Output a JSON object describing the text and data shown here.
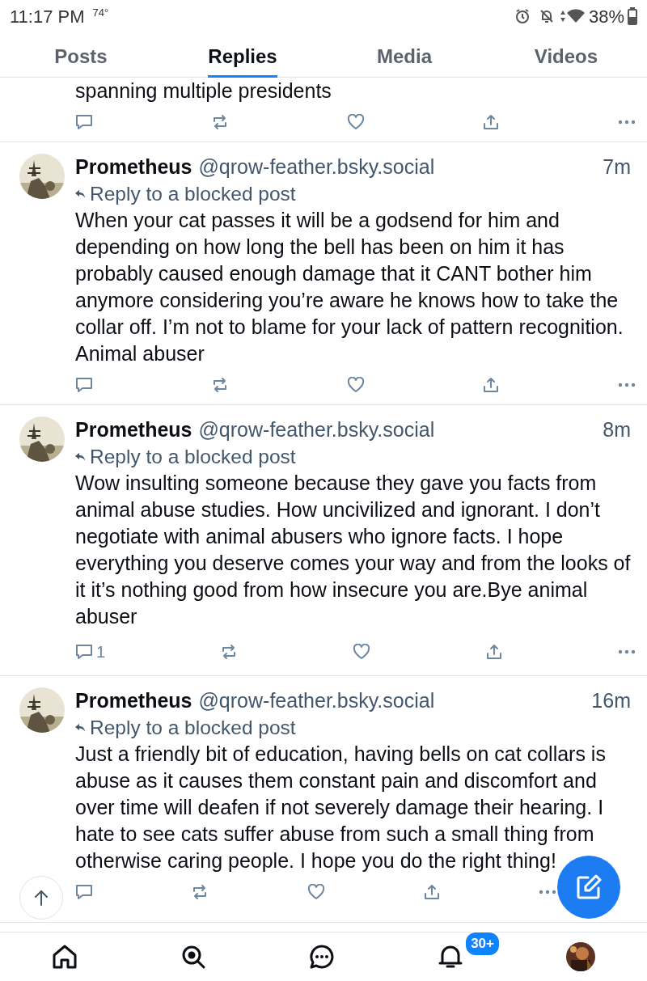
{
  "status_bar": {
    "time": "11:17 PM",
    "temperature": "74°",
    "battery": "38%"
  },
  "tabs": [
    {
      "label": "Posts",
      "selected": false
    },
    {
      "label": "Replies",
      "selected": true
    },
    {
      "label": "Media",
      "selected": false
    },
    {
      "label": "Videos",
      "selected": false
    }
  ],
  "posts": [
    {
      "kind": "continued",
      "text": "spanning multiple presidents"
    },
    {
      "kind": "full",
      "author": "Prometheus",
      "handle": "@qrow-feather.bsky.social",
      "time": "7m",
      "reply_note": "Reply to a blocked post",
      "text": "When your cat passes it will be a godsend for him and depending on how long the bell has been on him it has probably caused enough damage that it CANT bother him anymore considering you’re aware he knows how to take the collar off. I’m not to blame for your lack of pattern recognition. Animal abuser"
    },
    {
      "kind": "full",
      "author": "Prometheus",
      "handle": "@qrow-feather.bsky.social",
      "time": "8m",
      "reply_note": "Reply to a blocked post",
      "text": "Wow insulting someone because they gave you facts from animal abuse studies. How uncivilized and ignorant. I don’t negotiate with animal abusers who ignore facts. I hope everything you deserve comes your way and from the looks of it it’s nothing good from how insecure you are.Bye animal abuser",
      "reply_count": "1"
    },
    {
      "kind": "full",
      "author": "Prometheus",
      "handle": "@qrow-feather.bsky.social",
      "time": "16m",
      "reply_note": "Reply to a blocked post",
      "text": "Just a friendly bit of education, having bells on cat collars is abuse as it causes them constant pain and discomfort and over time will deafen if not severely damage their hearing. I hate to see cats suffer abuse from such a small thing from otherwise caring people. I hope you do the right thing!"
    }
  ],
  "bottom_nav": [
    {
      "kind": "home"
    },
    {
      "kind": "search"
    },
    {
      "kind": "chat"
    },
    {
      "kind": "notifications",
      "badge": "30+"
    },
    {
      "kind": "profile"
    }
  ]
}
